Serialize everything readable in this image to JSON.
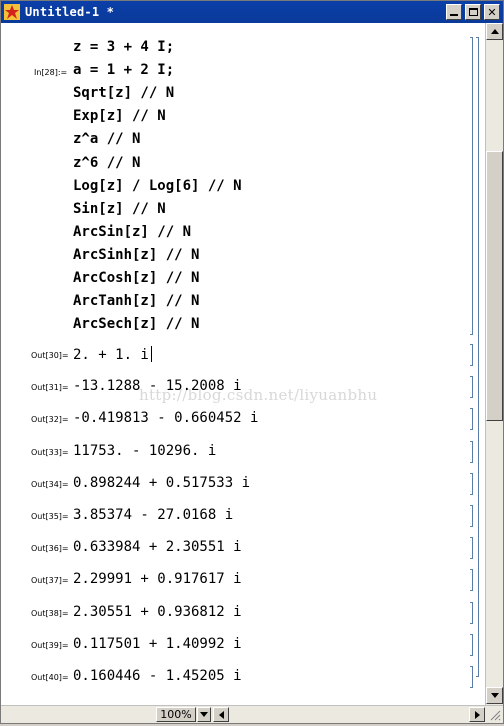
{
  "window": {
    "title": "Untitled-1 *"
  },
  "watermark": "http://blog.csdn.net/liyuanbhu",
  "input_cell": {
    "label": "In[28]:=",
    "lines": [
      "z = 3 + 4 I;",
      "a = 1 + 2 I;",
      "Sqrt[z] // N",
      "Exp[z] // N",
      "z^a // N",
      "z^6 // N",
      "Log[z] / Log[6] // N",
      "Sin[z] // N",
      "ArcSin[z] // N",
      "ArcSinh[z] // N",
      "ArcCosh[z] // N",
      "ArcTanh[z] // N",
      "ArcSech[z] // N"
    ]
  },
  "outputs": [
    {
      "label": "Out[30]=",
      "value": "2. + 1. i"
    },
    {
      "label": "Out[31]=",
      "value": "-13.1288 - 15.2008 i"
    },
    {
      "label": "Out[32]=",
      "value": "-0.419813 - 0.660452 i"
    },
    {
      "label": "Out[33]=",
      "value": "11753. - 10296. i"
    },
    {
      "label": "Out[34]=",
      "value": "0.898244 + 0.517533 i"
    },
    {
      "label": "Out[35]=",
      "value": "3.85374 - 27.0168 i"
    },
    {
      "label": "Out[36]=",
      "value": "0.633984 + 2.30551 i"
    },
    {
      "label": "Out[37]=",
      "value": "2.29991 + 0.917617 i"
    },
    {
      "label": "Out[38]=",
      "value": "2.30551 + 0.936812 i"
    },
    {
      "label": "Out[39]=",
      "value": "0.117501 + 1.40992 i"
    },
    {
      "label": "Out[40]=",
      "value": "0.160446 - 1.45205 i"
    }
  ],
  "statusbar": {
    "zoom": "100%"
  },
  "icons": {
    "app": "mathematica-star-icon",
    "minimize": "minimize-icon",
    "maximize": "maximize-icon",
    "close": "close-icon"
  },
  "colors": {
    "titlebar": "#0b3fa8",
    "bracket": "#5a7da8"
  }
}
